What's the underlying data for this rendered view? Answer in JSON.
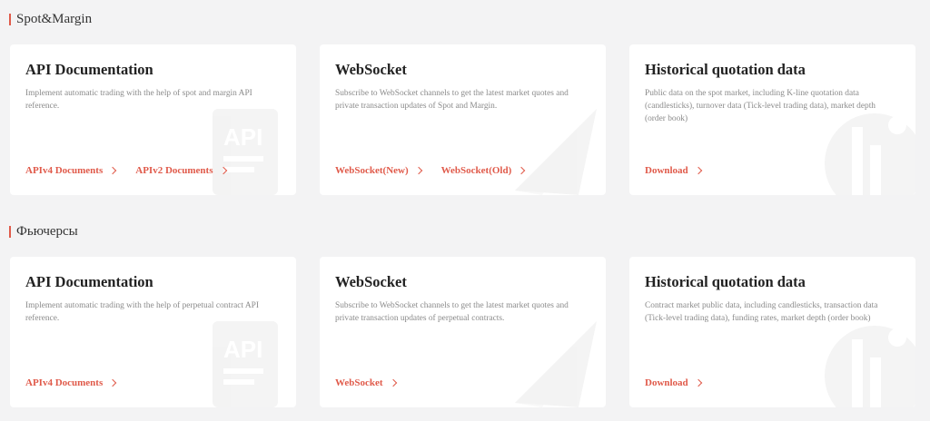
{
  "sections": [
    {
      "title": "Spot&Margin",
      "cards": [
        {
          "title": "API Documentation",
          "description": "Implement automatic trading with the help of spot and margin API reference.",
          "links": [
            "APIv4 Documents",
            "APIv2 Documents"
          ],
          "watermark_icon": "api-document-icon"
        },
        {
          "title": "WebSocket",
          "description": "Subscribe to WebSocket channels to get the latest market quotes and private transaction updates of Spot and Margin.",
          "links": [
            "WebSocket(New)",
            "WebSocket(Old)"
          ],
          "watermark_icon": "paper-plane-icon"
        },
        {
          "title": "Historical quotation data",
          "description": "Public data on the spot market, including K-line quotation data (candlesticks), turnover data (Tick-level trading data), market depth (order book)",
          "links": [
            "Download"
          ],
          "watermark_icon": "data-chart-icon"
        }
      ]
    },
    {
      "title": "Фьючерсы",
      "cards": [
        {
          "title": "API Documentation",
          "description": "Implement automatic trading with the help of perpetual contract API reference.",
          "links": [
            "APIv4 Documents"
          ],
          "watermark_icon": "api-document-icon"
        },
        {
          "title": "WebSocket",
          "description": "Subscribe to WebSocket channels to get the latest market quotes and private transaction updates of perpetual contracts.",
          "links": [
            "WebSocket"
          ],
          "watermark_icon": "paper-plane-icon"
        },
        {
          "title": "Historical quotation data",
          "description": "Contract market public data, including candlesticks, transaction data (Tick-level trading data), funding rates, market depth (order book)",
          "links": [
            "Download"
          ],
          "watermark_icon": "data-chart-icon"
        }
      ]
    }
  ],
  "colors": {
    "accent": "#e05a4a",
    "background": "#f3f3f4",
    "card": "#ffffff"
  }
}
